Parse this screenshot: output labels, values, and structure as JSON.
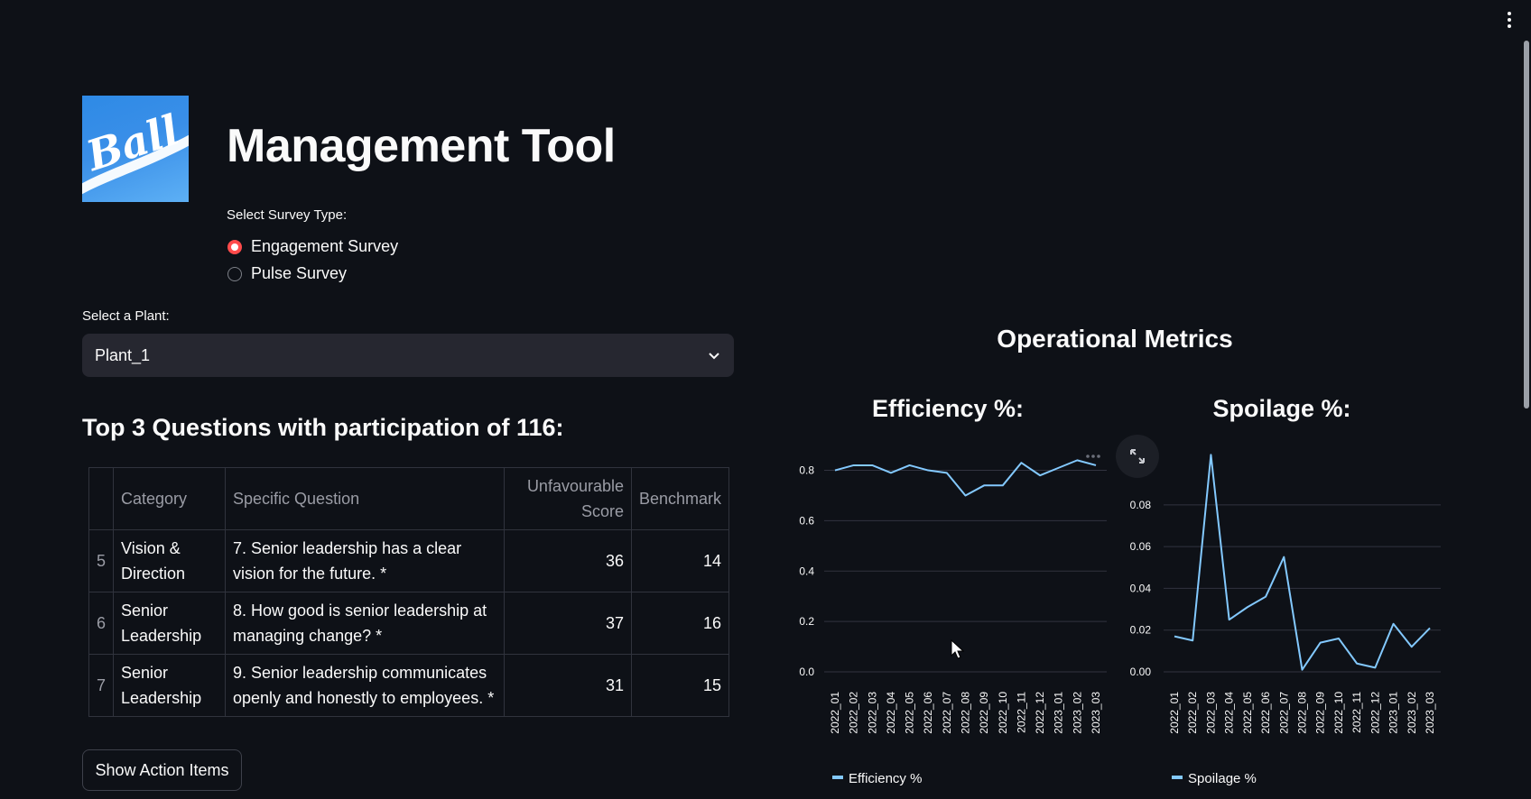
{
  "header": {
    "title": "Management Tool",
    "logo_text": "Ball"
  },
  "survey": {
    "label": "Select Survey Type:",
    "options": [
      "Engagement Survey",
      "Pulse Survey"
    ],
    "selected": "Engagement Survey"
  },
  "plant": {
    "label": "Select a Plant:",
    "value": "Plant_1"
  },
  "questions": {
    "heading": "Top 3 Questions with participation of 116:",
    "columns": [
      "",
      "Category",
      "Specific Question",
      "Unfavourable Score",
      "Benchmark"
    ],
    "rows": [
      {
        "index": "5",
        "category": "Vision & Direction",
        "question": "7. Senior leadership has a clear vision for the future. *",
        "score": "36",
        "benchmark": "14"
      },
      {
        "index": "6",
        "category": "Senior Leadership",
        "question": "8. How good is senior leadership at managing change? *",
        "score": "37",
        "benchmark": "16"
      },
      {
        "index": "7",
        "category": "Senior Leadership",
        "question": "9. Senior leadership communicates openly and honestly to employees. *",
        "score": "31",
        "benchmark": "15"
      }
    ]
  },
  "actions": {
    "show_label": "Show Action Items"
  },
  "operational": {
    "heading": "Operational Metrics"
  },
  "colors": {
    "background": "#0e1117",
    "accent": "#ff4b4b",
    "line": "#83c9ff",
    "grid": "#31333f"
  },
  "chart_data": [
    {
      "type": "line",
      "title": "Efficiency %:",
      "categories": [
        "2022_01",
        "2022_02",
        "2022_03",
        "2022_04",
        "2022_05",
        "2022_06",
        "2022_07",
        "2022_08",
        "2022_09",
        "2022_10",
        "2022_11",
        "2022_12",
        "2023_01",
        "2023_02",
        "2023_03"
      ],
      "series": [
        {
          "name": "Efficiency %",
          "values": [
            0.8,
            0.82,
            0.82,
            0.79,
            0.82,
            0.8,
            0.79,
            0.7,
            0.74,
            0.74,
            0.83,
            0.78,
            0.81,
            0.84,
            0.82
          ]
        }
      ],
      "yticks": [
        0.0,
        0.2,
        0.4,
        0.6,
        0.8
      ],
      "ylim": [
        0,
        0.87
      ],
      "grid": true,
      "legend": "bottom"
    },
    {
      "type": "line",
      "title": "Spoilage %:",
      "categories": [
        "2022_01",
        "2022_02",
        "2022_03",
        "2022_04",
        "2022_05",
        "2022_06",
        "2022_07",
        "2022_08",
        "2022_09",
        "2022_10",
        "2022_11",
        "2022_12",
        "2023_01",
        "2023_02",
        "2023_03"
      ],
      "series": [
        {
          "name": "Spoilage %",
          "values": [
            0.017,
            0.015,
            0.104,
            0.025,
            0.031,
            0.036,
            0.055,
            0.001,
            0.014,
            0.016,
            0.004,
            0.002,
            0.023,
            0.012,
            0.021
          ]
        }
      ],
      "yticks": [
        0.0,
        0.02,
        0.04,
        0.06,
        0.08
      ],
      "ylim": [
        0,
        0.105
      ],
      "grid": true,
      "legend": "bottom"
    }
  ]
}
